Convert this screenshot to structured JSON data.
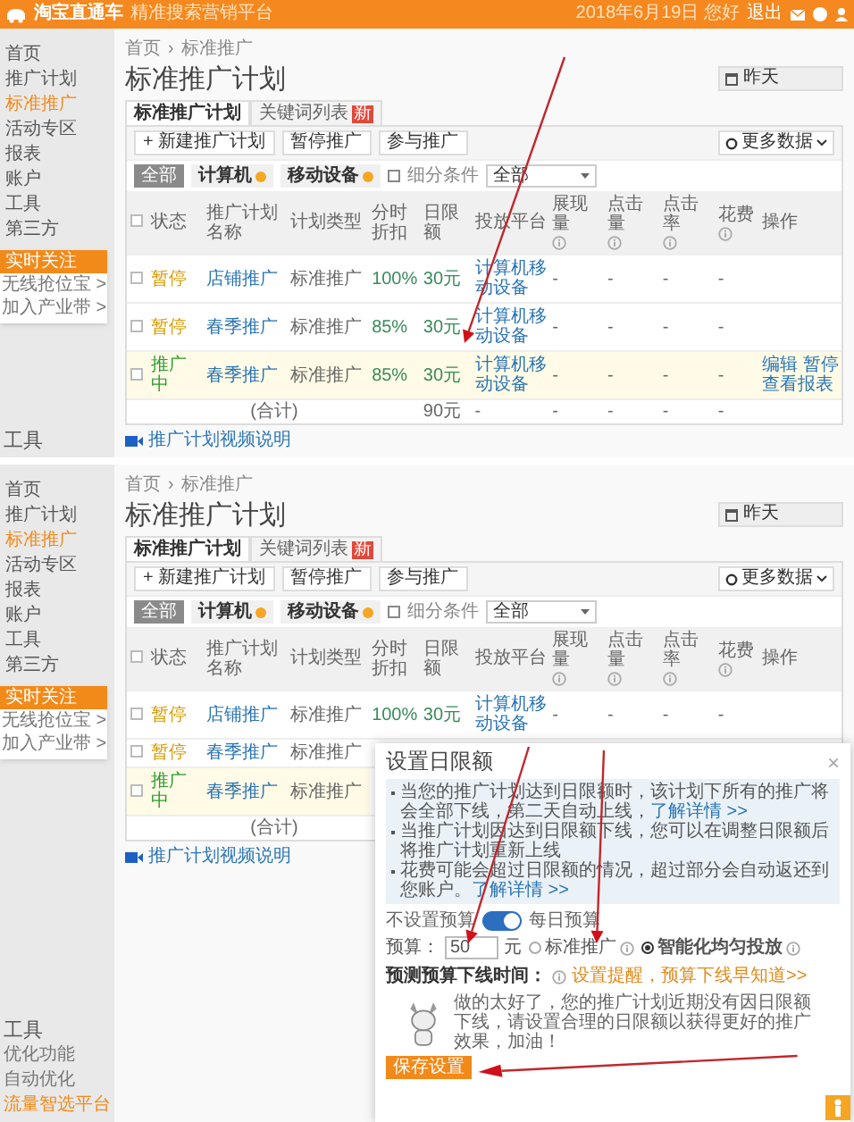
{
  "screens": [
    {
      "header": {
        "logo": "淘宝直通车",
        "logo_sub": "精准搜索营销平台",
        "account": "2018年6月19日 您好",
        "logout": "退出"
      },
      "sidebar": {
        "items": [
          {
            "label": "首页",
            "selected": false
          },
          {
            "label": "推广计划",
            "selected": false
          },
          {
            "label": "标准推广",
            "selected": true
          },
          {
            "label": "活动专区",
            "selected": false
          },
          {
            "label": "报表",
            "selected": false
          },
          {
            "label": "账户",
            "selected": false
          },
          {
            "label": "工具",
            "selected": false
          },
          {
            "label": "第三方",
            "selected": false
          }
        ],
        "promo": "实时关注",
        "links": [
          "无线抢位宝 >",
          "加入产业带 >"
        ],
        "bottom": [
          {
            "label": "工具",
            "kind": "section"
          }
        ]
      },
      "breadcrumb": {
        "home": "首页",
        "separator": "›",
        "current": "标准推广"
      },
      "title": "标准推广计划",
      "date_picker": "昨天",
      "tabs": [
        {
          "label": "标准推广计划",
          "selected": true
        },
        {
          "label": "关键词列表",
          "selected": false,
          "badge": "新"
        }
      ],
      "actions": [
        "+ 新建推广计划",
        "暂停推广",
        "参与推广"
      ],
      "more_data": "更多数据",
      "filters": [
        {
          "label": "全部",
          "selected": true
        },
        {
          "label": "计算机",
          "selected": false
        },
        {
          "label": "移动设备",
          "selected": false
        }
      ],
      "filter_label": "细分条件",
      "filter_value": "全部",
      "all_checked": false,
      "columns": [
        {
          "label": "状态"
        },
        {
          "label": "推广计划名称"
        },
        {
          "label": "计划类型"
        },
        {
          "label": "分时折扣"
        },
        {
          "label": "日限额"
        },
        {
          "label": "投放平台"
        },
        {
          "label": "展现量",
          "info": true
        },
        {
          "label": "点击量",
          "info": true
        },
        {
          "label": "点击率",
          "info": true
        },
        {
          "label": "花费",
          "info": true
        },
        {
          "label": "操作"
        }
      ],
      "rows": [
        {
          "checked": false,
          "highlighted": false,
          "kind": "paused",
          "cells": [
            "暂停",
            "店铺推广",
            "标准推广",
            "100%",
            "30元",
            "计算机移动设备",
            "-",
            "-",
            "-",
            "-"
          ],
          "actions": []
        },
        {
          "checked": false,
          "highlighted": false,
          "kind": "paused",
          "cells": [
            "暂停",
            "春季推广",
            "标准推广",
            "85%",
            "30元",
            "计算机移动设备",
            "-",
            "-",
            "-",
            "-"
          ],
          "actions": []
        },
        {
          "checked": false,
          "highlighted": true,
          "kind": "active",
          "cells": [
            "推广中",
            "春季推广",
            "标准推广",
            "85%",
            "30元",
            "计算机移动设备",
            "-",
            "-",
            "-",
            "-"
          ],
          "actions": [
            "编辑",
            "暂停",
            "查看报表"
          ]
        }
      ],
      "total": [
        "(合计)",
        "90元",
        "-",
        "-",
        "-",
        "-",
        "-"
      ],
      "video_link": "推广计划视频说明"
    },
    {
      "sidebar": {
        "items": [
          {
            "label": "首页",
            "selected": false
          },
          {
            "label": "推广计划",
            "selected": false
          },
          {
            "label": "标准推广",
            "selected": true
          },
          {
            "label": "活动专区",
            "selected": false
          },
          {
            "label": "报表",
            "selected": false
          },
          {
            "label": "账户",
            "selected": false
          },
          {
            "label": "工具",
            "selected": false
          },
          {
            "label": "第三方",
            "selected": false
          }
        ],
        "promo": "实时关注",
        "links": [
          "无线抢位宝 >",
          "加入产业带 >"
        ],
        "bottom": [
          {
            "label": "工具",
            "kind": "section"
          },
          {
            "label": "优化功能",
            "kind": "item"
          },
          {
            "label": "自动优化",
            "kind": "group"
          },
          {
            "label": "流量智选平台",
            "kind": "highlight"
          }
        ]
      },
      "breadcrumb": {
        "home": "首页",
        "separator": "›",
        "current": "标准推广"
      },
      "title": "标准推广计划",
      "date_picker": "昨天",
      "tabs": [
        {
          "label": "标准推广计划",
          "selected": true
        },
        {
          "label": "关键词列表",
          "selected": false,
          "badge": "新"
        }
      ],
      "actions": [
        "+ 新建推广计划",
        "暂停推广",
        "参与推广"
      ],
      "more_data": "更多数据",
      "filters": [
        {
          "label": "全部",
          "selected": true
        },
        {
          "label": "计算机",
          "selected": false
        },
        {
          "label": "移动设备",
          "selected": false
        }
      ],
      "filter_label": "细分条件",
      "filter_value": "全部",
      "all_checked": false,
      "columns": [
        {
          "label": "状态"
        },
        {
          "label": "推广计划名称"
        },
        {
          "label": "计划类型"
        },
        {
          "label": "分时折扣"
        },
        {
          "label": "日限额"
        },
        {
          "label": "投放平台"
        },
        {
          "label": "展现量",
          "info": true
        },
        {
          "label": "点击量",
          "info": true
        },
        {
          "label": "点击率",
          "info": true
        },
        {
          "label": "花费",
          "info": true
        },
        {
          "label": "操作"
        }
      ],
      "rows": [
        {
          "checked": false,
          "highlighted": false,
          "kind": "paused",
          "cells": [
            "暂停",
            "店铺推广",
            "标准推广",
            "100%",
            "30元",
            "计算机移动设备",
            "-",
            "-",
            "-",
            "-"
          ],
          "actions": []
        },
        {
          "checked": false,
          "highlighted": false,
          "kind": "paused",
          "cells": [
            "暂停",
            "春季推广",
            "标准推广"
          ],
          "actions": []
        },
        {
          "checked": false,
          "highlighted": true,
          "kind": "active",
          "cells": [
            "推广中",
            "春季推广",
            "标准推广"
          ],
          "actions": []
        }
      ],
      "total": [
        "(合计)"
      ],
      "video_link": "推广计划视频说明",
      "dialog": {
        "title": "设置日限额",
        "close": "×",
        "notes": [
          {
            "text": "当您的推广计划达到日限额时，该计划下所有的推广将会全部下线，第二天自动上线，",
            "link": "了解详情 >>"
          },
          {
            "text": "当推广计划因达到日限额下线，您可以在调整日限额后将推广计划重新上线"
          },
          {
            "text": "花费可能会超过日限额的情况，超过部分会自动返还到您账户。",
            "link": "了解详情 >>"
          }
        ],
        "toggle": {
          "off_label": "不设置预算",
          "on_label": "每日预算",
          "on": true
        },
        "budget": {
          "label": "预算：",
          "value": "50",
          "unit": "元"
        },
        "modes": [
          {
            "label": "标准推广",
            "selected": false
          },
          {
            "label": "智能化均匀投放",
            "selected": true
          }
        ],
        "offline": {
          "label": "预测预算下线时间：",
          "link": "设置提醒，预算下线早知道>>"
        },
        "message": "做的太好了，您的推广计划近期没有因日限额下线，请设置合理的日限额以获得更好的推广效果，加油！",
        "save": "保存设置"
      }
    }
  ]
}
